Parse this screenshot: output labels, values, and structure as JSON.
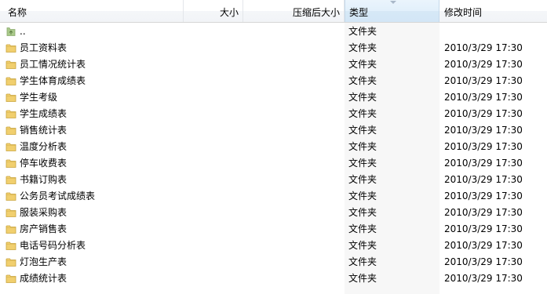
{
  "columns": {
    "name": "名称",
    "size": "大小",
    "compressed_size": "压缩后大小",
    "type": "类型",
    "modified": "修改时间"
  },
  "rows": [
    {
      "name": "..",
      "type": "文件夹",
      "modified": "",
      "icon": "folder-up-icon"
    },
    {
      "name": "员工资料表",
      "type": "文件夹",
      "modified": "2010/3/29 17:30",
      "icon": "folder-icon"
    },
    {
      "name": "员工情况统计表",
      "type": "文件夹",
      "modified": "2010/3/29 17:30",
      "icon": "folder-icon"
    },
    {
      "name": "学生体育成绩表",
      "type": "文件夹",
      "modified": "2010/3/29 17:30",
      "icon": "folder-icon"
    },
    {
      "name": "学生考级",
      "type": "文件夹",
      "modified": "2010/3/29 17:30",
      "icon": "folder-icon"
    },
    {
      "name": "学生成绩表",
      "type": "文件夹",
      "modified": "2010/3/29 17:30",
      "icon": "folder-icon"
    },
    {
      "name": "销售统计表",
      "type": "文件夹",
      "modified": "2010/3/29 17:30",
      "icon": "folder-icon"
    },
    {
      "name": "温度分析表",
      "type": "文件夹",
      "modified": "2010/3/29 17:30",
      "icon": "folder-icon"
    },
    {
      "name": "停车收费表",
      "type": "文件夹",
      "modified": "2010/3/29 17:30",
      "icon": "folder-icon"
    },
    {
      "name": "书籍订购表",
      "type": "文件夹",
      "modified": "2010/3/29 17:30",
      "icon": "folder-icon"
    },
    {
      "name": "公务员考试成绩表",
      "type": "文件夹",
      "modified": "2010/3/29 17:30",
      "icon": "folder-icon"
    },
    {
      "name": "服装采购表",
      "type": "文件夹",
      "modified": "2010/3/29 17:30",
      "icon": "folder-icon"
    },
    {
      "name": "房产销售表",
      "type": "文件夹",
      "modified": "2010/3/29 17:30",
      "icon": "folder-icon"
    },
    {
      "name": "电话号码分析表",
      "type": "文件夹",
      "modified": "2010/3/29 17:30",
      "icon": "folder-icon"
    },
    {
      "name": "灯泡生产表",
      "type": "文件夹",
      "modified": "2010/3/29 17:30",
      "icon": "folder-icon"
    },
    {
      "name": "成绩统计表",
      "type": "文件夹",
      "modified": "2010/3/29 17:30",
      "icon": "folder-icon"
    }
  ],
  "colors": {
    "folder_yellow": "#f1cf6e",
    "folder_up_green": "#a9c98a",
    "sorted_column_bg": "#f7f7f7",
    "header_active_bg": "#dcecf9"
  }
}
